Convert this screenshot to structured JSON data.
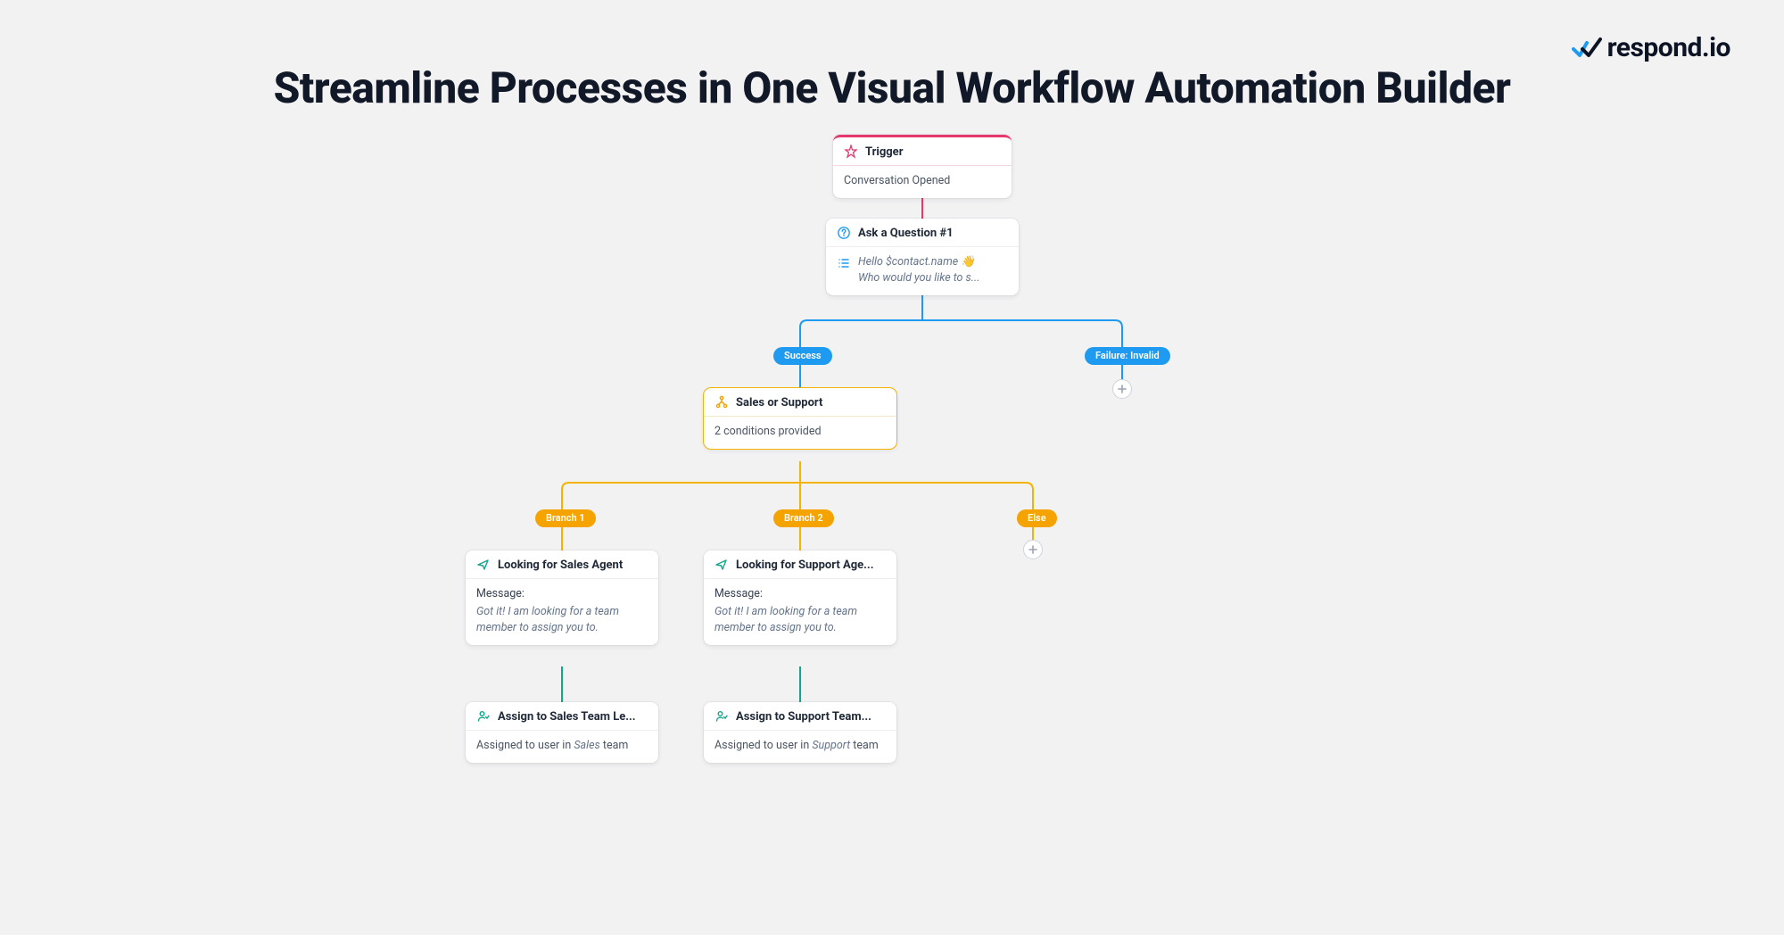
{
  "brand": {
    "name": "respond.io"
  },
  "page": {
    "title": "Streamline Processes in One Visual Workflow Automation Builder"
  },
  "workflow": {
    "trigger": {
      "title": "Trigger",
      "description": "Conversation Opened"
    },
    "ask": {
      "title": "Ask a Question #1",
      "line1": "Hello $contact.name 👋",
      "line2": "Who would you like to s..."
    },
    "askOutcomes": {
      "success": "Success",
      "failure": "Failure: Invalid"
    },
    "branch": {
      "title": "Sales or Support",
      "subtitle": "2 conditions provided"
    },
    "branchLabels": {
      "b1": "Branch 1",
      "b2": "Branch 2",
      "else": "Else"
    },
    "sales": {
      "look": {
        "title": "Looking for Sales Agent",
        "label": "Message:",
        "body": "Got it! I am looking for a team member to assign you to."
      },
      "assign": {
        "title": "Assign to Sales Team Le...",
        "body_pre": "Assigned to user in ",
        "body_em": "Sales",
        "body_post": " team"
      }
    },
    "support": {
      "look": {
        "title": "Looking for Support Age...",
        "label": "Message:",
        "body": "Got it! I am looking for a team member to assign you to."
      },
      "assign": {
        "title": "Assign to Support Team...",
        "body_pre": "Assigned to user in ",
        "body_em": "Support",
        "body_post": " team"
      }
    }
  }
}
